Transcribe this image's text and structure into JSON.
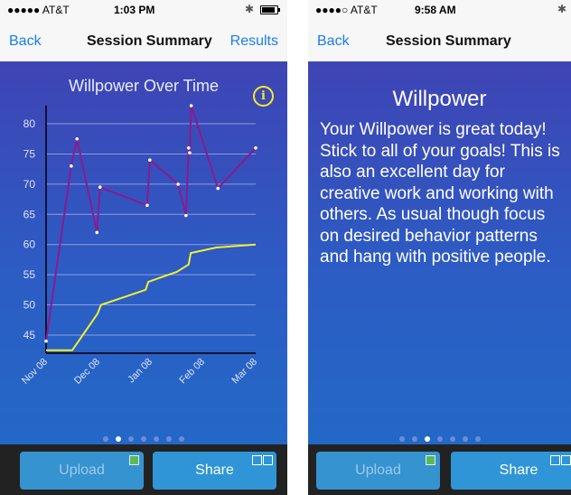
{
  "left_phone": {
    "status": {
      "carrier": "●●●●● AT&T",
      "time": "1:03 PM"
    },
    "nav": {
      "back": "Back",
      "title": "Session Summary",
      "results": "Results"
    },
    "info_icon_glyph": "i",
    "buttons": {
      "upload": "Upload",
      "share": "Share"
    }
  },
  "right_phone": {
    "status": {
      "carrier": "●●●●○ AT&T",
      "time": "9:58 AM"
    },
    "nav": {
      "back": "Back",
      "title": "Session Summary"
    },
    "heading": "Willpower",
    "body": "Your Willpower is great today! Stick to all of your goals! This is also an excellent day for creative work and working with others. As usual though focus on desired behavior patterns and hang with positive people.",
    "buttons": {
      "upload": "Upload",
      "share": "Share"
    }
  },
  "colors": {
    "series1": "#8b1a8e",
    "series2": "#f2ef2e",
    "accent": "#1a7cf5",
    "info": "#f4ea2a"
  },
  "chart_data": {
    "type": "line",
    "title": "Willpower Over Time",
    "xlabel": "",
    "ylabel": "",
    "ylim": [
      42,
      83
    ],
    "xlim": [
      0,
      4
    ],
    "x_tick_labels": [
      "Nov 08",
      "Dec 08",
      "Jan 08",
      "Feb 08",
      "Mar 08"
    ],
    "y_ticks": [
      45,
      50,
      55,
      60,
      65,
      70,
      75,
      80
    ],
    "grid": true,
    "series": [
      {
        "color": "#8b1a8e",
        "markers": true,
        "points": [
          [
            0,
            44
          ],
          [
            0.48,
            73
          ],
          [
            0.59,
            77.5
          ],
          [
            0.97,
            62
          ],
          [
            1.03,
            69.5
          ],
          [
            1.93,
            66.5
          ],
          [
            1.98,
            74
          ],
          [
            2.52,
            70
          ],
          [
            2.67,
            64.8
          ],
          [
            2.72,
            76
          ],
          [
            2.74,
            75.2
          ],
          [
            2.77,
            83
          ],
          [
            3.28,
            69.3
          ],
          [
            4,
            76
          ]
        ]
      },
      {
        "color": "#f2ef2e",
        "markers": false,
        "points": [
          [
            0,
            42.5
          ],
          [
            0.5,
            42.5
          ],
          [
            0.98,
            48.5
          ],
          [
            1.05,
            50
          ],
          [
            1.9,
            52.5
          ],
          [
            1.95,
            53.8
          ],
          [
            2.5,
            55.5
          ],
          [
            2.72,
            56.7
          ],
          [
            2.76,
            58.6
          ],
          [
            3.25,
            59.5
          ],
          [
            4,
            60
          ]
        ]
      }
    ]
  }
}
